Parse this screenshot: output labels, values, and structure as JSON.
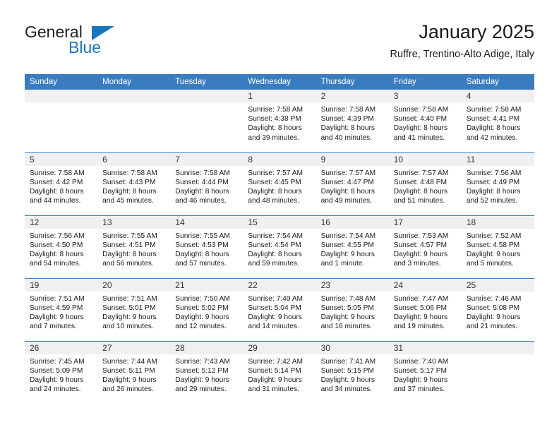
{
  "brand": {
    "name_dark": "General",
    "name_blue": "Blue",
    "triangle_icon": "triangle-icon",
    "accent_color": "#1b75bb"
  },
  "header": {
    "title": "January 2025",
    "subtitle": "Ruffre, Trentino-Alto Adige, Italy",
    "header_bg_color": "#3a7cc0",
    "band_bg_color": "#f0f0f0"
  },
  "weekday_headers": [
    "Sunday",
    "Monday",
    "Tuesday",
    "Wednesday",
    "Thursday",
    "Friday",
    "Saturday"
  ],
  "labels": {
    "sunrise_prefix": "Sunrise:",
    "sunset_prefix": "Sunset:",
    "daylight_prefix": "Daylight:"
  },
  "weeks": [
    [
      {
        "day": "",
        "sunrise": "",
        "sunset": "",
        "daylight_line1": "",
        "daylight_line2": "",
        "empty": true
      },
      {
        "day": "",
        "sunrise": "",
        "sunset": "",
        "daylight_line1": "",
        "daylight_line2": "",
        "empty": true
      },
      {
        "day": "",
        "sunrise": "",
        "sunset": "",
        "daylight_line1": "",
        "daylight_line2": "",
        "empty": true
      },
      {
        "day": "1",
        "sunrise": "Sunrise: 7:58 AM",
        "sunset": "Sunset: 4:38 PM",
        "daylight_line1": "Daylight: 8 hours",
        "daylight_line2": "and 39 minutes."
      },
      {
        "day": "2",
        "sunrise": "Sunrise: 7:58 AM",
        "sunset": "Sunset: 4:39 PM",
        "daylight_line1": "Daylight: 8 hours",
        "daylight_line2": "and 40 minutes."
      },
      {
        "day": "3",
        "sunrise": "Sunrise: 7:58 AM",
        "sunset": "Sunset: 4:40 PM",
        "daylight_line1": "Daylight: 8 hours",
        "daylight_line2": "and 41 minutes."
      },
      {
        "day": "4",
        "sunrise": "Sunrise: 7:58 AM",
        "sunset": "Sunset: 4:41 PM",
        "daylight_line1": "Daylight: 8 hours",
        "daylight_line2": "and 42 minutes."
      }
    ],
    [
      {
        "day": "5",
        "sunrise": "Sunrise: 7:58 AM",
        "sunset": "Sunset: 4:42 PM",
        "daylight_line1": "Daylight: 8 hours",
        "daylight_line2": "and 44 minutes."
      },
      {
        "day": "6",
        "sunrise": "Sunrise: 7:58 AM",
        "sunset": "Sunset: 4:43 PM",
        "daylight_line1": "Daylight: 8 hours",
        "daylight_line2": "and 45 minutes."
      },
      {
        "day": "7",
        "sunrise": "Sunrise: 7:58 AM",
        "sunset": "Sunset: 4:44 PM",
        "daylight_line1": "Daylight: 8 hours",
        "daylight_line2": "and 46 minutes."
      },
      {
        "day": "8",
        "sunrise": "Sunrise: 7:57 AM",
        "sunset": "Sunset: 4:45 PM",
        "daylight_line1": "Daylight: 8 hours",
        "daylight_line2": "and 48 minutes."
      },
      {
        "day": "9",
        "sunrise": "Sunrise: 7:57 AM",
        "sunset": "Sunset: 4:47 PM",
        "daylight_line1": "Daylight: 8 hours",
        "daylight_line2": "and 49 minutes."
      },
      {
        "day": "10",
        "sunrise": "Sunrise: 7:57 AM",
        "sunset": "Sunset: 4:48 PM",
        "daylight_line1": "Daylight: 8 hours",
        "daylight_line2": "and 51 minutes."
      },
      {
        "day": "11",
        "sunrise": "Sunrise: 7:56 AM",
        "sunset": "Sunset: 4:49 PM",
        "daylight_line1": "Daylight: 8 hours",
        "daylight_line2": "and 52 minutes."
      }
    ],
    [
      {
        "day": "12",
        "sunrise": "Sunrise: 7:56 AM",
        "sunset": "Sunset: 4:50 PM",
        "daylight_line1": "Daylight: 8 hours",
        "daylight_line2": "and 54 minutes."
      },
      {
        "day": "13",
        "sunrise": "Sunrise: 7:55 AM",
        "sunset": "Sunset: 4:51 PM",
        "daylight_line1": "Daylight: 8 hours",
        "daylight_line2": "and 56 minutes."
      },
      {
        "day": "14",
        "sunrise": "Sunrise: 7:55 AM",
        "sunset": "Sunset: 4:53 PM",
        "daylight_line1": "Daylight: 8 hours",
        "daylight_line2": "and 57 minutes."
      },
      {
        "day": "15",
        "sunrise": "Sunrise: 7:54 AM",
        "sunset": "Sunset: 4:54 PM",
        "daylight_line1": "Daylight: 8 hours",
        "daylight_line2": "and 59 minutes."
      },
      {
        "day": "16",
        "sunrise": "Sunrise: 7:54 AM",
        "sunset": "Sunset: 4:55 PM",
        "daylight_line1": "Daylight: 9 hours",
        "daylight_line2": "and 1 minute."
      },
      {
        "day": "17",
        "sunrise": "Sunrise: 7:53 AM",
        "sunset": "Sunset: 4:57 PM",
        "daylight_line1": "Daylight: 9 hours",
        "daylight_line2": "and 3 minutes."
      },
      {
        "day": "18",
        "sunrise": "Sunrise: 7:52 AM",
        "sunset": "Sunset: 4:58 PM",
        "daylight_line1": "Daylight: 9 hours",
        "daylight_line2": "and 5 minutes."
      }
    ],
    [
      {
        "day": "19",
        "sunrise": "Sunrise: 7:51 AM",
        "sunset": "Sunset: 4:59 PM",
        "daylight_line1": "Daylight: 9 hours",
        "daylight_line2": "and 7 minutes."
      },
      {
        "day": "20",
        "sunrise": "Sunrise: 7:51 AM",
        "sunset": "Sunset: 5:01 PM",
        "daylight_line1": "Daylight: 9 hours",
        "daylight_line2": "and 10 minutes."
      },
      {
        "day": "21",
        "sunrise": "Sunrise: 7:50 AM",
        "sunset": "Sunset: 5:02 PM",
        "daylight_line1": "Daylight: 9 hours",
        "daylight_line2": "and 12 minutes."
      },
      {
        "day": "22",
        "sunrise": "Sunrise: 7:49 AM",
        "sunset": "Sunset: 5:04 PM",
        "daylight_line1": "Daylight: 9 hours",
        "daylight_line2": "and 14 minutes."
      },
      {
        "day": "23",
        "sunrise": "Sunrise: 7:48 AM",
        "sunset": "Sunset: 5:05 PM",
        "daylight_line1": "Daylight: 9 hours",
        "daylight_line2": "and 16 minutes."
      },
      {
        "day": "24",
        "sunrise": "Sunrise: 7:47 AM",
        "sunset": "Sunset: 5:06 PM",
        "daylight_line1": "Daylight: 9 hours",
        "daylight_line2": "and 19 minutes."
      },
      {
        "day": "25",
        "sunrise": "Sunrise: 7:46 AM",
        "sunset": "Sunset: 5:08 PM",
        "daylight_line1": "Daylight: 9 hours",
        "daylight_line2": "and 21 minutes."
      }
    ],
    [
      {
        "day": "26",
        "sunrise": "Sunrise: 7:45 AM",
        "sunset": "Sunset: 5:09 PM",
        "daylight_line1": "Daylight: 9 hours",
        "daylight_line2": "and 24 minutes."
      },
      {
        "day": "27",
        "sunrise": "Sunrise: 7:44 AM",
        "sunset": "Sunset: 5:11 PM",
        "daylight_line1": "Daylight: 9 hours",
        "daylight_line2": "and 26 minutes."
      },
      {
        "day": "28",
        "sunrise": "Sunrise: 7:43 AM",
        "sunset": "Sunset: 5:12 PM",
        "daylight_line1": "Daylight: 9 hours",
        "daylight_line2": "and 29 minutes."
      },
      {
        "day": "29",
        "sunrise": "Sunrise: 7:42 AM",
        "sunset": "Sunset: 5:14 PM",
        "daylight_line1": "Daylight: 9 hours",
        "daylight_line2": "and 31 minutes."
      },
      {
        "day": "30",
        "sunrise": "Sunrise: 7:41 AM",
        "sunset": "Sunset: 5:15 PM",
        "daylight_line1": "Daylight: 9 hours",
        "daylight_line2": "and 34 minutes."
      },
      {
        "day": "31",
        "sunrise": "Sunrise: 7:40 AM",
        "sunset": "Sunset: 5:17 PM",
        "daylight_line1": "Daylight: 9 hours",
        "daylight_line2": "and 37 minutes."
      },
      {
        "day": "",
        "sunrise": "",
        "sunset": "",
        "daylight_line1": "",
        "daylight_line2": "",
        "empty": true
      }
    ]
  ]
}
